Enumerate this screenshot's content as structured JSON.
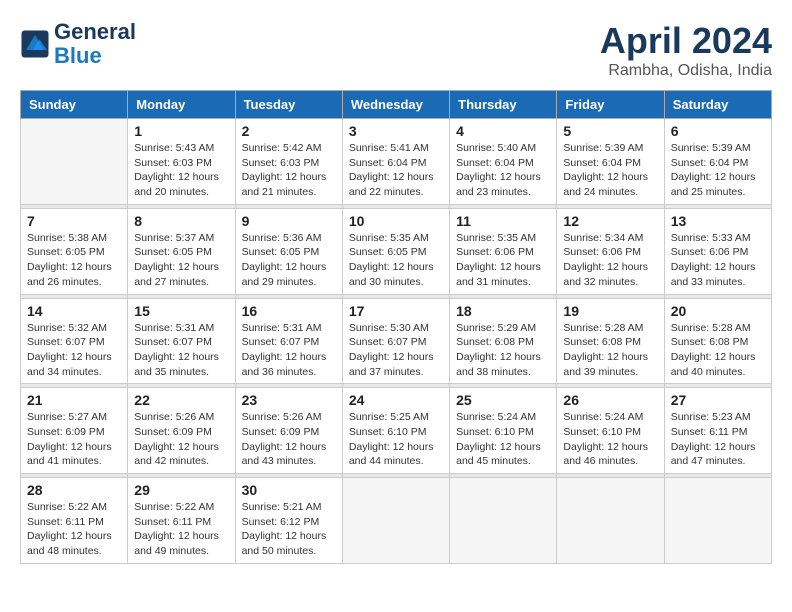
{
  "header": {
    "logo_line1": "General",
    "logo_line2": "Blue",
    "title": "April 2024",
    "subtitle": "Rambha, Odisha, India"
  },
  "weekdays": [
    "Sunday",
    "Monday",
    "Tuesday",
    "Wednesday",
    "Thursday",
    "Friday",
    "Saturday"
  ],
  "weeks": [
    [
      {
        "day": "",
        "info": ""
      },
      {
        "day": "1",
        "info": "Sunrise: 5:43 AM\nSunset: 6:03 PM\nDaylight: 12 hours\nand 20 minutes."
      },
      {
        "day": "2",
        "info": "Sunrise: 5:42 AM\nSunset: 6:03 PM\nDaylight: 12 hours\nand 21 minutes."
      },
      {
        "day": "3",
        "info": "Sunrise: 5:41 AM\nSunset: 6:04 PM\nDaylight: 12 hours\nand 22 minutes."
      },
      {
        "day": "4",
        "info": "Sunrise: 5:40 AM\nSunset: 6:04 PM\nDaylight: 12 hours\nand 23 minutes."
      },
      {
        "day": "5",
        "info": "Sunrise: 5:39 AM\nSunset: 6:04 PM\nDaylight: 12 hours\nand 24 minutes."
      },
      {
        "day": "6",
        "info": "Sunrise: 5:39 AM\nSunset: 6:04 PM\nDaylight: 12 hours\nand 25 minutes."
      }
    ],
    [
      {
        "day": "7",
        "info": "Sunrise: 5:38 AM\nSunset: 6:05 PM\nDaylight: 12 hours\nand 26 minutes."
      },
      {
        "day": "8",
        "info": "Sunrise: 5:37 AM\nSunset: 6:05 PM\nDaylight: 12 hours\nand 27 minutes."
      },
      {
        "day": "9",
        "info": "Sunrise: 5:36 AM\nSunset: 6:05 PM\nDaylight: 12 hours\nand 29 minutes."
      },
      {
        "day": "10",
        "info": "Sunrise: 5:35 AM\nSunset: 6:05 PM\nDaylight: 12 hours\nand 30 minutes."
      },
      {
        "day": "11",
        "info": "Sunrise: 5:35 AM\nSunset: 6:06 PM\nDaylight: 12 hours\nand 31 minutes."
      },
      {
        "day": "12",
        "info": "Sunrise: 5:34 AM\nSunset: 6:06 PM\nDaylight: 12 hours\nand 32 minutes."
      },
      {
        "day": "13",
        "info": "Sunrise: 5:33 AM\nSunset: 6:06 PM\nDaylight: 12 hours\nand 33 minutes."
      }
    ],
    [
      {
        "day": "14",
        "info": "Sunrise: 5:32 AM\nSunset: 6:07 PM\nDaylight: 12 hours\nand 34 minutes."
      },
      {
        "day": "15",
        "info": "Sunrise: 5:31 AM\nSunset: 6:07 PM\nDaylight: 12 hours\nand 35 minutes."
      },
      {
        "day": "16",
        "info": "Sunrise: 5:31 AM\nSunset: 6:07 PM\nDaylight: 12 hours\nand 36 minutes."
      },
      {
        "day": "17",
        "info": "Sunrise: 5:30 AM\nSunset: 6:07 PM\nDaylight: 12 hours\nand 37 minutes."
      },
      {
        "day": "18",
        "info": "Sunrise: 5:29 AM\nSunset: 6:08 PM\nDaylight: 12 hours\nand 38 minutes."
      },
      {
        "day": "19",
        "info": "Sunrise: 5:28 AM\nSunset: 6:08 PM\nDaylight: 12 hours\nand 39 minutes."
      },
      {
        "day": "20",
        "info": "Sunrise: 5:28 AM\nSunset: 6:08 PM\nDaylight: 12 hours\nand 40 minutes."
      }
    ],
    [
      {
        "day": "21",
        "info": "Sunrise: 5:27 AM\nSunset: 6:09 PM\nDaylight: 12 hours\nand 41 minutes."
      },
      {
        "day": "22",
        "info": "Sunrise: 5:26 AM\nSunset: 6:09 PM\nDaylight: 12 hours\nand 42 minutes."
      },
      {
        "day": "23",
        "info": "Sunrise: 5:26 AM\nSunset: 6:09 PM\nDaylight: 12 hours\nand 43 minutes."
      },
      {
        "day": "24",
        "info": "Sunrise: 5:25 AM\nSunset: 6:10 PM\nDaylight: 12 hours\nand 44 minutes."
      },
      {
        "day": "25",
        "info": "Sunrise: 5:24 AM\nSunset: 6:10 PM\nDaylight: 12 hours\nand 45 minutes."
      },
      {
        "day": "26",
        "info": "Sunrise: 5:24 AM\nSunset: 6:10 PM\nDaylight: 12 hours\nand 46 minutes."
      },
      {
        "day": "27",
        "info": "Sunrise: 5:23 AM\nSunset: 6:11 PM\nDaylight: 12 hours\nand 47 minutes."
      }
    ],
    [
      {
        "day": "28",
        "info": "Sunrise: 5:22 AM\nSunset: 6:11 PM\nDaylight: 12 hours\nand 48 minutes."
      },
      {
        "day": "29",
        "info": "Sunrise: 5:22 AM\nSunset: 6:11 PM\nDaylight: 12 hours\nand 49 minutes."
      },
      {
        "day": "30",
        "info": "Sunrise: 5:21 AM\nSunset: 6:12 PM\nDaylight: 12 hours\nand 50 minutes."
      },
      {
        "day": "",
        "info": ""
      },
      {
        "day": "",
        "info": ""
      },
      {
        "day": "",
        "info": ""
      },
      {
        "day": "",
        "info": ""
      }
    ]
  ]
}
